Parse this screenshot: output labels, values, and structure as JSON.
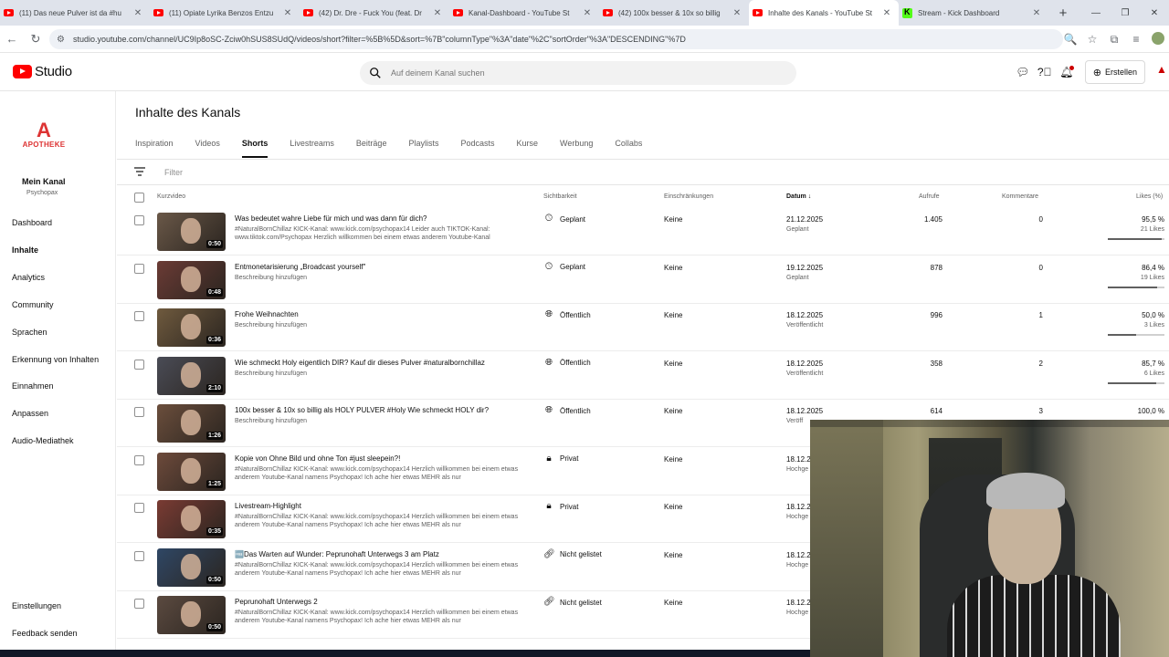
{
  "browser": {
    "tabs": [
      {
        "title": "(11) Das neue Pulver ist da #hu",
        "icon": "youtube-icon",
        "active": false
      },
      {
        "title": "(11) Opiate Lyrika Benzos Entzu",
        "icon": "youtube-icon",
        "active": false
      },
      {
        "title": "(42) Dr. Dre - Fuck You (feat. Dr",
        "icon": "youtube-icon",
        "active": false
      },
      {
        "title": "Kanal-Dashboard - YouTube St",
        "icon": "youtube-icon",
        "active": false
      },
      {
        "title": "(42) 100x besser & 10x so billig",
        "icon": "youtube-icon",
        "active": false
      },
      {
        "title": "Inhalte des Kanals - YouTube St",
        "icon": "studio-icon",
        "active": true
      },
      {
        "title": "Stream - Kick Dashboard",
        "icon": "kick-icon",
        "active": false
      }
    ],
    "url": "studio.youtube.com/channel/UC9Ip8oSC-Zciw0hSUS8SUdQ/videos/short?filter=%5B%5D&sort=%7B\"columnType\"%3A\"date\"%2C\"sortOrder\"%3A\"DESCENDING\"%7D"
  },
  "header": {
    "logo_text": "Studio",
    "search_placeholder": "Auf deinem Kanal suchen",
    "create_label": "Erstellen"
  },
  "sidebar": {
    "channel_logo_text": "APOTHEKE",
    "channel_title": "Mein Kanal",
    "channel_handle": "Psychopax",
    "items": [
      {
        "label": "Dashboard",
        "active": false
      },
      {
        "label": "Inhalte",
        "active": true
      },
      {
        "label": "Analytics",
        "active": false
      },
      {
        "label": "Community",
        "active": false
      },
      {
        "label": "Sprachen",
        "active": false
      },
      {
        "label": "Erkennung von Inhalten",
        "active": false
      },
      {
        "label": "Einnahmen",
        "active": false
      },
      {
        "label": "Anpassen",
        "active": false
      },
      {
        "label": "Audio-Mediathek",
        "active": false
      }
    ],
    "bottom_items": [
      {
        "label": "Einstellungen"
      },
      {
        "label": "Feedback senden"
      }
    ]
  },
  "main": {
    "title": "Inhalte des Kanals",
    "tabs": [
      {
        "label": "Inspiration",
        "active": false
      },
      {
        "label": "Videos",
        "active": false
      },
      {
        "label": "Shorts",
        "active": true
      },
      {
        "label": "Livestreams",
        "active": false
      },
      {
        "label": "Beiträge",
        "active": false
      },
      {
        "label": "Playlists",
        "active": false
      },
      {
        "label": "Podcasts",
        "active": false
      },
      {
        "label": "Kurse",
        "active": false
      },
      {
        "label": "Werbung",
        "active": false
      },
      {
        "label": "Collabs",
        "active": false
      }
    ],
    "filter_placeholder": "Filter",
    "columns": {
      "video": "Kurzvideo",
      "visibility": "Sichtbarkeit",
      "restrictions": "Einschränkungen",
      "date": "Datum",
      "views": "Aufrufe",
      "comments": "Kommentare",
      "likes": "Likes (%)"
    },
    "rows": [
      {
        "title": "Was bedeutet wahre Liebe für mich und was dann für dich?",
        "desc": "#NaturalBornChillaz KICK-Kanal: www.kick.com/psychopax14 Leider auch TIKTOK-Kanal: www.tiktok.com/Psychopax Herzlich willkommen bei einem etwas anderem Youtube-Kanal",
        "duration": "0:50",
        "visibility": "Geplant",
        "vis_icon": "clock-icon",
        "restrictions": "Keine",
        "date": "21.12.2025",
        "date_sub": "Geplant",
        "views": "1.405",
        "comments": "0",
        "likes_pct": "95,5 %",
        "likes_count": "21 Likes",
        "likes_ratio": 0.955,
        "thumb": "#6a5848"
      },
      {
        "title": "Entmonetarisierung „Broadcast yourself\"",
        "desc": "Beschreibung hinzufügen",
        "duration": "0:48",
        "visibility": "Geplant",
        "vis_icon": "clock-icon",
        "restrictions": "Keine",
        "date": "19.12.2025",
        "date_sub": "Geplant",
        "views": "878",
        "comments": "0",
        "likes_pct": "86,4 %",
        "likes_count": "19 Likes",
        "likes_ratio": 0.864,
        "thumb": "#6b3b35"
      },
      {
        "title": "Frohe Weihnachten",
        "desc": "Beschreibung hinzufügen",
        "duration": "0:36",
        "visibility": "Öffentlich",
        "vis_icon": "globe-icon",
        "restrictions": "Keine",
        "date": "18.12.2025",
        "date_sub": "Veröffentlicht",
        "views": "996",
        "comments": "1",
        "likes_pct": "50,0 %",
        "likes_count": "3 Likes",
        "likes_ratio": 0.5,
        "thumb": "#6f5a3e"
      },
      {
        "title": "Wie schmeckt Holy eigentlich DIR? Kauf dir dieses Pulver #naturalbornchillaz",
        "desc": "Beschreibung hinzufügen",
        "duration": "2:10",
        "visibility": "Öffentlich",
        "vis_icon": "globe-icon",
        "restrictions": "Keine",
        "date": "18.12.2025",
        "date_sub": "Veröffentlicht",
        "views": "358",
        "comments": "2",
        "likes_pct": "85,7 %",
        "likes_count": "6 Likes",
        "likes_ratio": 0.857,
        "thumb": "#4a4c56"
      },
      {
        "title": "100x besser & 10x so billig als HOLY PULVER #Holy Wie schmeckt HOLY dir?",
        "desc": "Beschreibung hinzufügen",
        "duration": "1:26",
        "visibility": "Öffentlich",
        "vis_icon": "globe-icon",
        "restrictions": "Keine",
        "date": "18.12.2025",
        "date_sub": "Veröff",
        "views": "614",
        "comments": "3",
        "likes_pct": "100,0 %",
        "likes_count": "",
        "likes_ratio": 1.0,
        "thumb": "#6b4e3c"
      },
      {
        "title": "Kopie von Ohne Bild und ohne Ton #just sleepein?!",
        "desc": "#NaturalBornChillaz KICK-Kanal: www.kick.com/psychopax14 Herzlich willkommen bei einem etwas anderem Youtube-Kanal namens Psychopax! Ich ache hier etwas MEHR als nur",
        "duration": "1:25",
        "visibility": "Privat",
        "vis_icon": "lock-icon",
        "restrictions": "Keine",
        "date": "18.12.2",
        "date_sub": "Hochge",
        "views": "",
        "comments": "",
        "likes_pct": "",
        "likes_count": "",
        "likes_ratio": 0,
        "thumb": "#6d4a3b"
      },
      {
        "title": "Livestream-Highlight",
        "desc": "#NaturalBornChillaz KICK-Kanal: www.kick.com/psychopax14 Herzlich willkommen bei einem etwas anderem Youtube-Kanal namens Psychopax! Ich ache hier etwas MEHR als nur",
        "duration": "0:35",
        "visibility": "Privat",
        "vis_icon": "lock-icon",
        "restrictions": "Keine",
        "date": "18.12.2",
        "date_sub": "Hochge",
        "views": "",
        "comments": "",
        "likes_pct": "",
        "likes_count": "",
        "likes_ratio": 0,
        "thumb": "#7a3b33"
      },
      {
        "title": "🆓Das Warten auf Wunder: Peprunohaft Unterwegs 3 am Platz",
        "desc": "#NaturalBornChillaz KICK-Kanal: www.kick.com/psychopax14 Herzlich willkommen bei einem etwas anderem Youtube-Kanal namens Psychopax! Ich ache hier etwas MEHR als nur",
        "duration": "0:50",
        "visibility": "Nicht gelistet",
        "vis_icon": "link-icon",
        "restrictions": "Keine",
        "date": "18.12.2",
        "date_sub": "Hochge",
        "views": "",
        "comments": "",
        "likes_pct": "",
        "likes_count": "",
        "likes_ratio": 0,
        "thumb": "#2f4765"
      },
      {
        "title": "Peprunohaft Unterwegs 2",
        "desc": "#NaturalBornChillaz KICK-Kanal: www.kick.com/psychopax14 Herzlich willkommen bei einem etwas anderem Youtube-Kanal namens Psychopax! Ich ache hier etwas MEHR als nur",
        "duration": "0:50",
        "visibility": "Nicht gelistet",
        "vis_icon": "link-icon",
        "restrictions": "Keine",
        "date": "18.12.2",
        "date_sub": "Hochge",
        "views": "",
        "comments": "",
        "likes_pct": "",
        "likes_count": "",
        "likes_ratio": 0,
        "thumb": "#5b4a40"
      }
    ]
  },
  "colors": {
    "accent": "#ff0000",
    "kick": "#53fc18"
  }
}
